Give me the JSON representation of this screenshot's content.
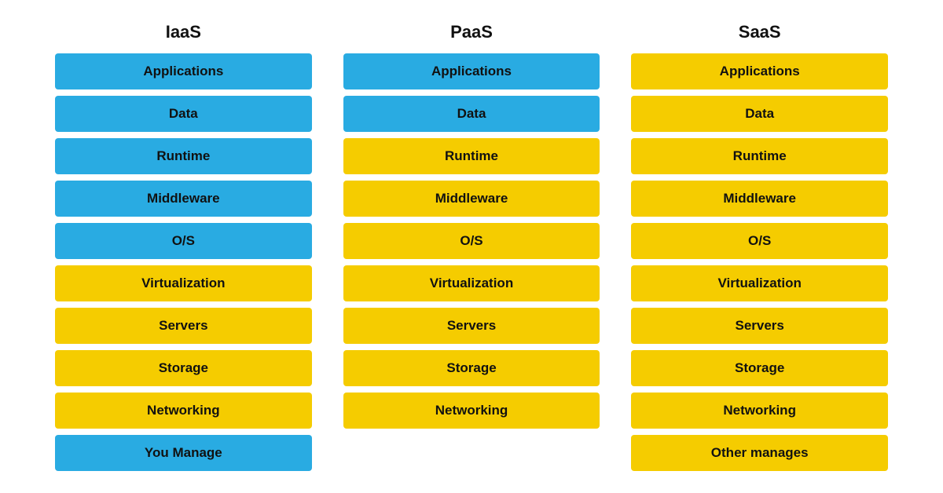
{
  "columns": [
    {
      "id": "iaas",
      "header": "IaaS",
      "rows": [
        {
          "label": "Applications",
          "color": "blue"
        },
        {
          "label": "Data",
          "color": "blue"
        },
        {
          "label": "Runtime",
          "color": "blue"
        },
        {
          "label": "Middleware",
          "color": "blue"
        },
        {
          "label": "O/S",
          "color": "blue"
        },
        {
          "label": "Virtualization",
          "color": "yellow"
        },
        {
          "label": "Servers",
          "color": "yellow"
        },
        {
          "label": "Storage",
          "color": "yellow"
        },
        {
          "label": "Networking",
          "color": "yellow"
        }
      ],
      "legend": {
        "label": "You Manage",
        "color": "blue"
      }
    },
    {
      "id": "paas",
      "header": "PaaS",
      "rows": [
        {
          "label": "Applications",
          "color": "blue"
        },
        {
          "label": "Data",
          "color": "blue"
        },
        {
          "label": "Runtime",
          "color": "yellow"
        },
        {
          "label": "Middleware",
          "color": "yellow"
        },
        {
          "label": "O/S",
          "color": "yellow"
        },
        {
          "label": "Virtualization",
          "color": "yellow"
        },
        {
          "label": "Servers",
          "color": "yellow"
        },
        {
          "label": "Storage",
          "color": "yellow"
        },
        {
          "label": "Networking",
          "color": "yellow"
        }
      ],
      "legend": null
    },
    {
      "id": "saas",
      "header": "SaaS",
      "rows": [
        {
          "label": "Applications",
          "color": "yellow"
        },
        {
          "label": "Data",
          "color": "yellow"
        },
        {
          "label": "Runtime",
          "color": "yellow"
        },
        {
          "label": "Middleware",
          "color": "yellow"
        },
        {
          "label": "O/S",
          "color": "yellow"
        },
        {
          "label": "Virtualization",
          "color": "yellow"
        },
        {
          "label": "Servers",
          "color": "yellow"
        },
        {
          "label": "Storage",
          "color": "yellow"
        },
        {
          "label": "Networking",
          "color": "yellow"
        }
      ],
      "legend": {
        "label": "Other manages",
        "color": "yellow"
      }
    }
  ]
}
